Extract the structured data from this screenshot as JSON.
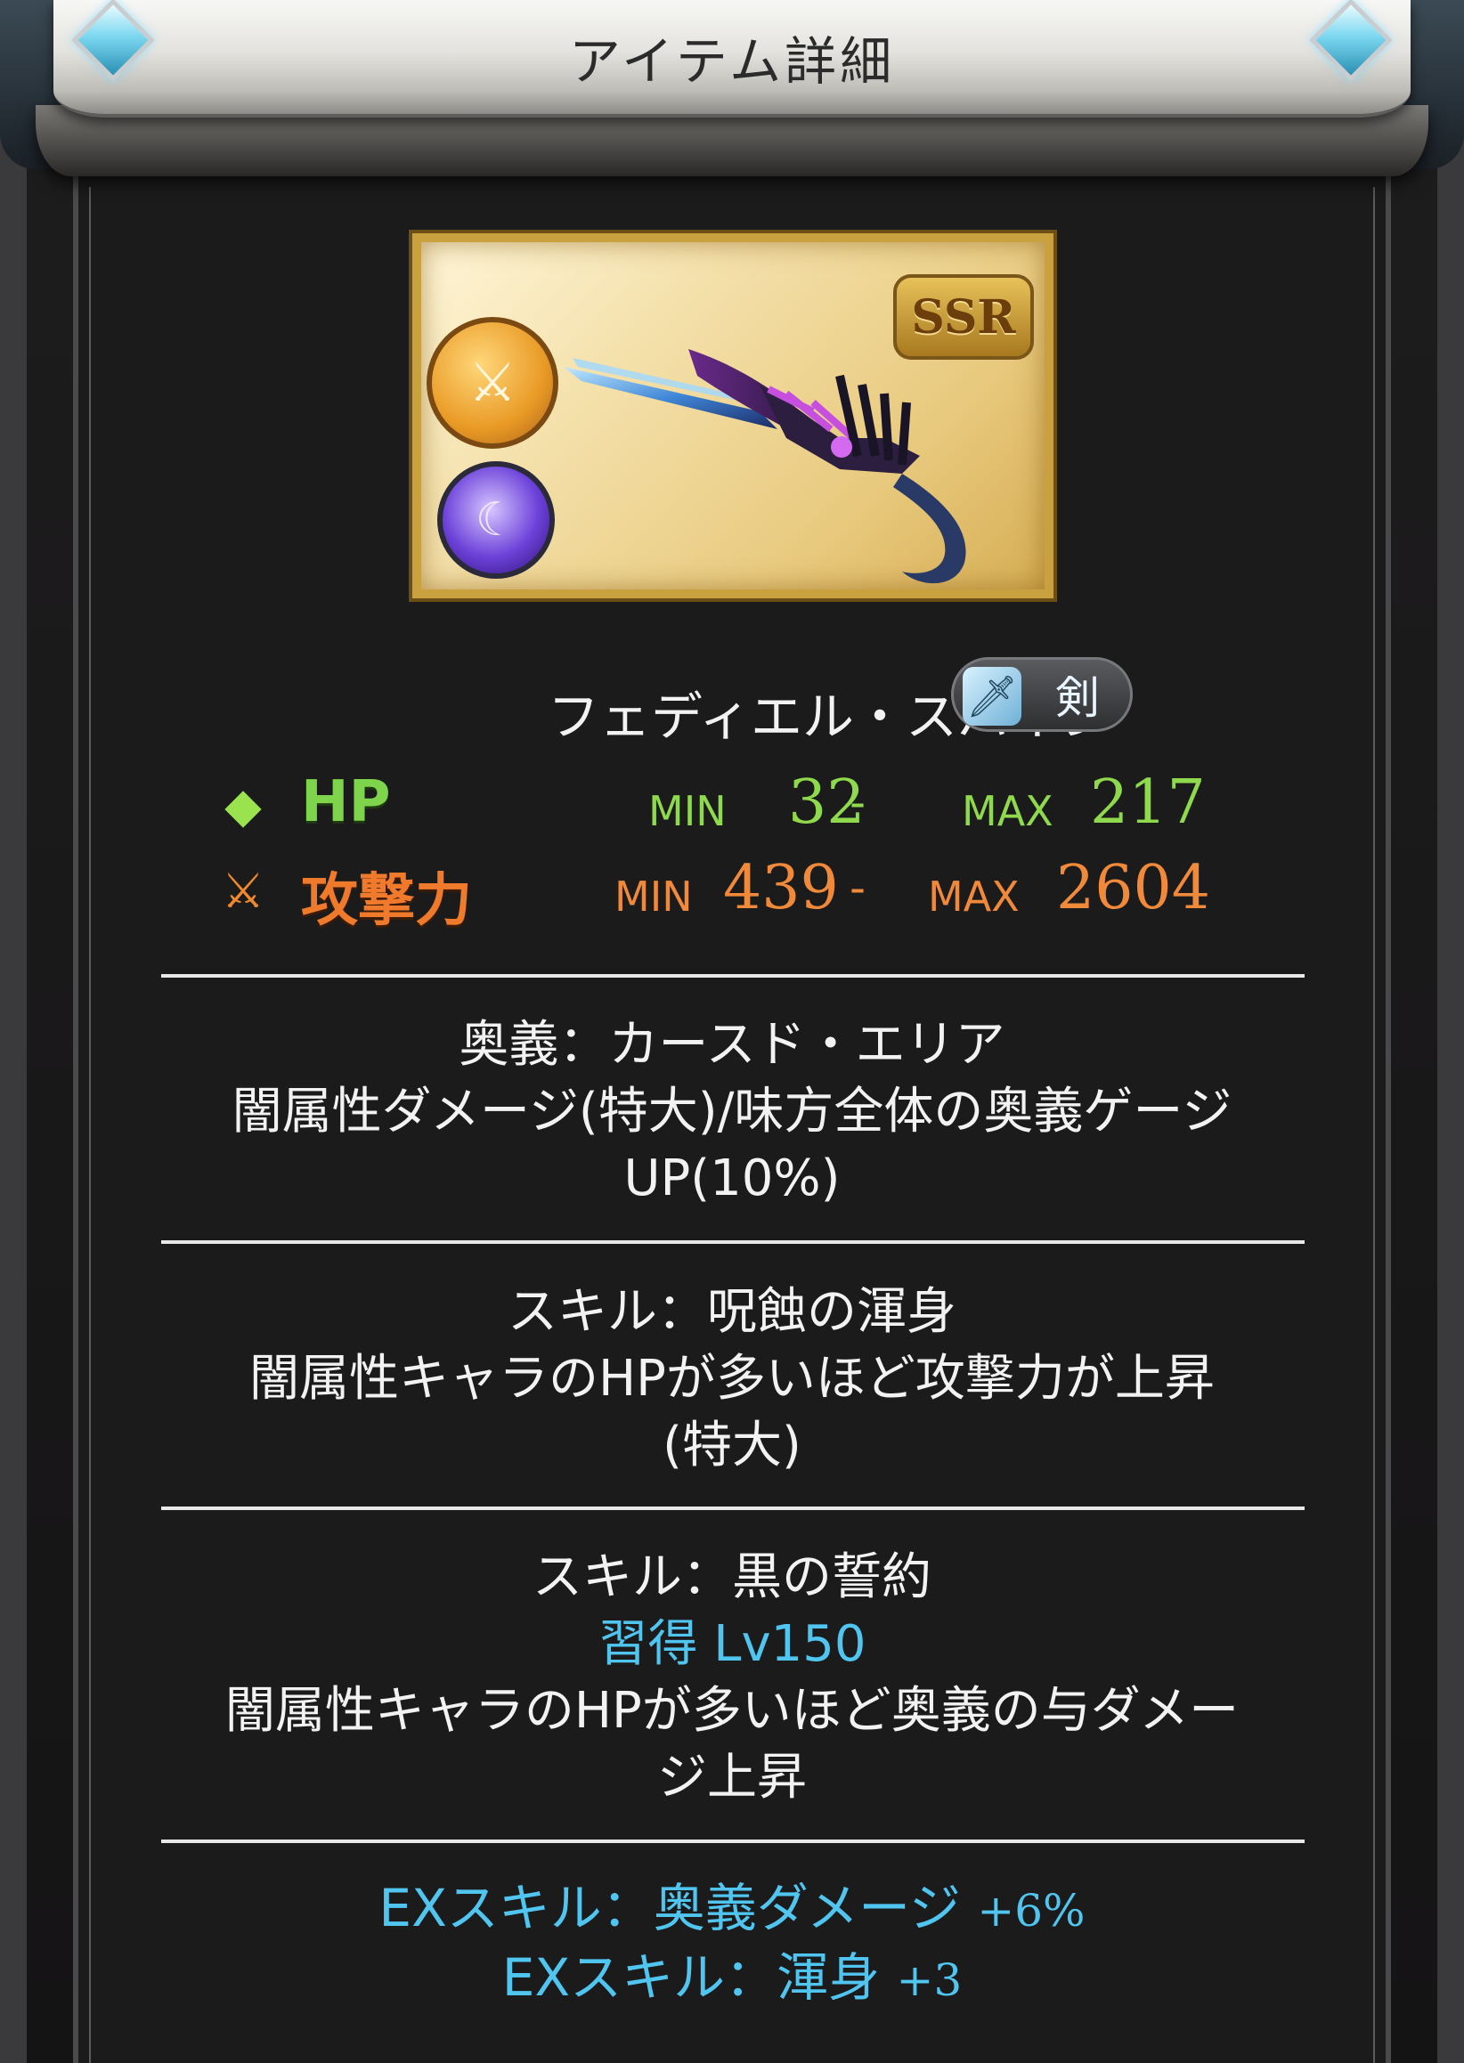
{
  "window": {
    "title": "アイテム詳細"
  },
  "item": {
    "name": "フェディエル・スパイン",
    "rarity": "SSR",
    "weapon_type": "剣",
    "type_icon": "sword-icon",
    "element_icon": "dark-element-icon",
    "element_color": "#6c41d9",
    "rarity_color": "#c9a13e"
  },
  "stats": {
    "hp": {
      "label": "HP",
      "min_label": "MIN",
      "min_value": "32",
      "dash": "-",
      "max_label": "MAX",
      "max_value": "217",
      "color": "#8fd94c"
    },
    "attack": {
      "label": "攻撃力",
      "min_label": "MIN",
      "min_value": "439",
      "dash": "-",
      "max_label": "MAX",
      "max_value": "2604",
      "color": "#f08a3a"
    }
  },
  "ougi": {
    "title": "奥義：カースド・エリア",
    "line1": "闇属性ダメージ(特大)/味方全体の奥義ゲージ",
    "line2": "UP(10%)"
  },
  "skill1": {
    "title": "スキル：呪蝕の渾身",
    "line1": "闇属性キャラのHPが多いほど攻撃力が上昇",
    "line2": "(特大)"
  },
  "skill2": {
    "title": "スキル：黒の誓約",
    "unlock": "習得 Lv150",
    "line1": "闇属性キャラのHPが多いほど奥義の与ダメー",
    "line2": "ジ上昇"
  },
  "ex_skills": [
    {
      "label": "EXスキル：奥義ダメージ",
      "bonus": "+6%"
    },
    {
      "label": "EXスキル：渾身",
      "bonus": "+3"
    }
  ],
  "colors": {
    "accent": "#4fc5f0",
    "text": "#f2f2f2",
    "divider": "#e9e9e9"
  }
}
